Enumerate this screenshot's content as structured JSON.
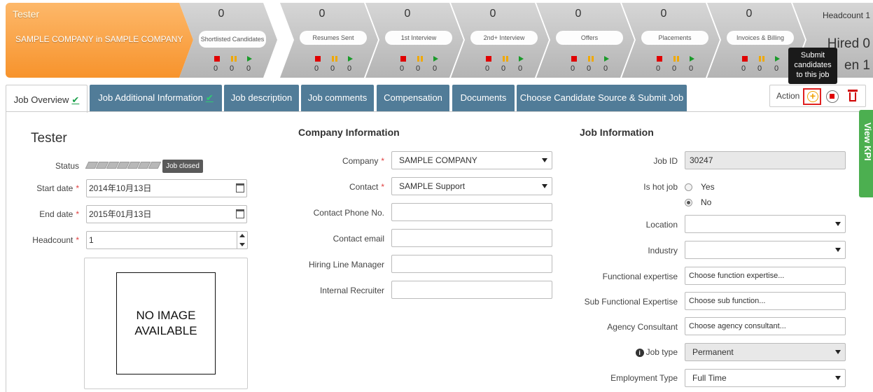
{
  "pipeline": {
    "job_title": "Tester",
    "company_line": "SAMPLE COMPANY in SAMPLE COMPANY",
    "stages": [
      {
        "label": "Shortlisted Candidates",
        "count": "0",
        "stopped": "0",
        "paused": "0",
        "active": "0"
      },
      {
        "label": "Resumes Sent",
        "count": "0",
        "stopped": "0",
        "paused": "0",
        "active": "0"
      },
      {
        "label": "1st Interview",
        "count": "0",
        "stopped": "0",
        "paused": "0",
        "active": "0"
      },
      {
        "label": "2nd+ Interview",
        "count": "0",
        "stopped": "0",
        "paused": "0",
        "active": "0"
      },
      {
        "label": "Offers",
        "count": "0",
        "stopped": "0",
        "paused": "0",
        "active": "0"
      },
      {
        "label": "Placements",
        "count": "0",
        "stopped": "0",
        "paused": "0",
        "active": "0"
      },
      {
        "label": "Invoices & Billing",
        "count": "0",
        "stopped": "0",
        "paused": "0",
        "active": "0"
      }
    ],
    "headcount_label": "Headcount 1",
    "hired_label": "Hired 0",
    "open_label": "en 1"
  },
  "tooltip": {
    "text_line1": "Submit",
    "text_line2": "candidates",
    "text_line3": "to this job"
  },
  "tabs": [
    {
      "label": "Job Overview",
      "check": "✔"
    },
    {
      "label": "Job Additional Information",
      "check": "✔"
    },
    {
      "label": "Job description"
    },
    {
      "label": "Job comments"
    },
    {
      "label": "Compensation"
    },
    {
      "label": "Documents"
    },
    {
      "label": "Choose Candidate Source & Submit Job"
    }
  ],
  "action": {
    "label": "Action",
    "plus": "+"
  },
  "view_kpi": {
    "label": "View KPI"
  },
  "overview": {
    "title": "Tester",
    "status_label": "Status",
    "status_value": "Job closed",
    "start_date_label": "Start date",
    "start_date_value": "2014年10月13日",
    "end_date_label": "End date",
    "end_date_value": "2015年01月13日",
    "headcount_label": "Headcount",
    "headcount_value": "1",
    "no_image_line1": "NO IMAGE",
    "no_image_line2": "AVAILABLE",
    "required_mark": "*"
  },
  "company": {
    "heading": "Company Information",
    "company_label": "Company",
    "company_value": "SAMPLE COMPANY",
    "contact_label": "Contact",
    "contact_value": "SAMPLE Support",
    "phone_label": "Contact Phone No.",
    "phone_value": "",
    "email_label": "Contact email",
    "email_value": "",
    "hiring_label": "Hiring Line Manager",
    "hiring_value": "",
    "recruiter_label": "Internal Recruiter",
    "recruiter_value": ""
  },
  "job": {
    "heading": "Job Information",
    "id_label": "Job ID",
    "id_value": "30247",
    "hot_label": "Is hot job",
    "yes_label": "Yes",
    "no_label": "No",
    "hot_selected": "No",
    "location_label": "Location",
    "location_value": "",
    "industry_label": "Industry",
    "industry_value": "",
    "func_label": "Functional expertise",
    "func_placeholder": "Choose function expertise...",
    "subfunc_label": "Sub Functional Expertise",
    "subfunc_placeholder": "Choose sub function...",
    "agency_label": "Agency Consultant",
    "agency_placeholder": "Choose agency consultant...",
    "type_label": "Job type",
    "type_value": "Permanent",
    "employment_label": "Employment Type",
    "employment_value": "Full Time"
  },
  "colors": {
    "tab_blue": "#517c98",
    "accent_orange": "#f7932c",
    "check_green": "#1aa04a",
    "kpi_green": "#4caf50"
  }
}
